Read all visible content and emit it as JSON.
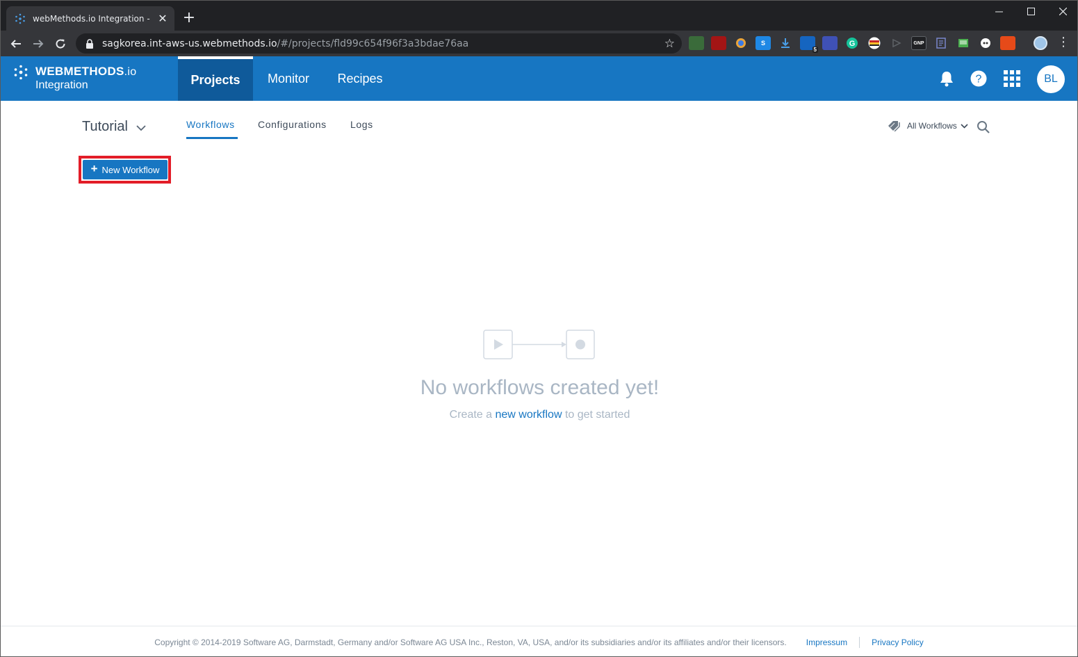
{
  "browser": {
    "tab_title": "webMethods.io Integration - W",
    "tab_close": "✕",
    "new_tab": "+",
    "url_host": "sagkorea.int-aws-us.webmethods.io",
    "url_path": "/#/projects/fld99c654f96f3a3bdae76aa",
    "extensions": [
      "5",
      "GNP"
    ]
  },
  "app": {
    "brand": "WEBMETHODS",
    "brand_suffix": ".io",
    "product": "Integration",
    "nav": [
      "Projects",
      "Monitor",
      "Recipes"
    ],
    "avatar_initials": "BL"
  },
  "project": {
    "name": "Tutorial",
    "tabs": [
      "Workflows",
      "Configurations",
      "Logs"
    ],
    "filter_label": "All Workflows",
    "new_button": "New Workflow"
  },
  "empty_state": {
    "title": "No workflows created yet!",
    "sub_prefix": "Create a ",
    "sub_link": "new workflow",
    "sub_suffix": " to get started"
  },
  "footer": {
    "copyright": "Copyright © 2014-2019 Software AG, Darmstadt, Germany and/or Software AG USA Inc., Reston, VA, USA, and/or its subsidiaries and/or its affiliates and/or their licensors.",
    "impressum": "Impressum",
    "privacy": "Privacy Policy"
  },
  "colors": {
    "brand_blue": "#1776c2",
    "nav_active": "#0f5a9a",
    "highlight_red": "#e21d28"
  }
}
